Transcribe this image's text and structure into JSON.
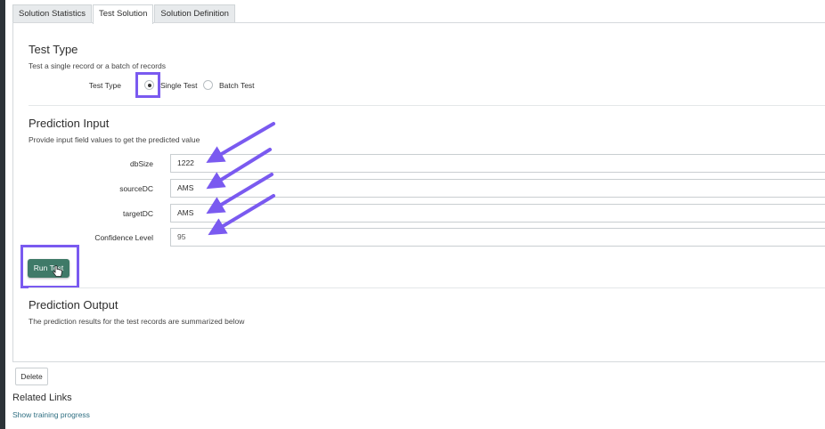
{
  "tabs": [
    {
      "label": "Solution Statistics",
      "active": false
    },
    {
      "label": "Test Solution",
      "active": true
    },
    {
      "label": "Solution Definition",
      "active": false
    }
  ],
  "test_type": {
    "title": "Test Type",
    "description": "Test a single record or a batch of records",
    "field_label": "Test Type",
    "options": [
      {
        "label": "Single Test",
        "selected": true
      },
      {
        "label": "Batch Test",
        "selected": false
      }
    ]
  },
  "prediction_input": {
    "title": "Prediction Input",
    "description": "Provide input field values to get the predicted value",
    "fields": [
      {
        "label": "dbSize",
        "value": "1222"
      },
      {
        "label": "sourceDC",
        "value": "AMS"
      },
      {
        "label": "targetDC",
        "value": "AMS"
      },
      {
        "label": "Confidence Level",
        "value": "95"
      }
    ],
    "run_button_label": "Run Test"
  },
  "prediction_output": {
    "title": "Prediction Output",
    "description": "The prediction results for the test records are summarized below"
  },
  "delete_label": "Delete",
  "related_links": {
    "title": "Related Links",
    "link": "Show training progress"
  },
  "colors": {
    "annotation": "#7a5af0",
    "run_button": "#3f7a68",
    "link": "#2f6f82"
  }
}
